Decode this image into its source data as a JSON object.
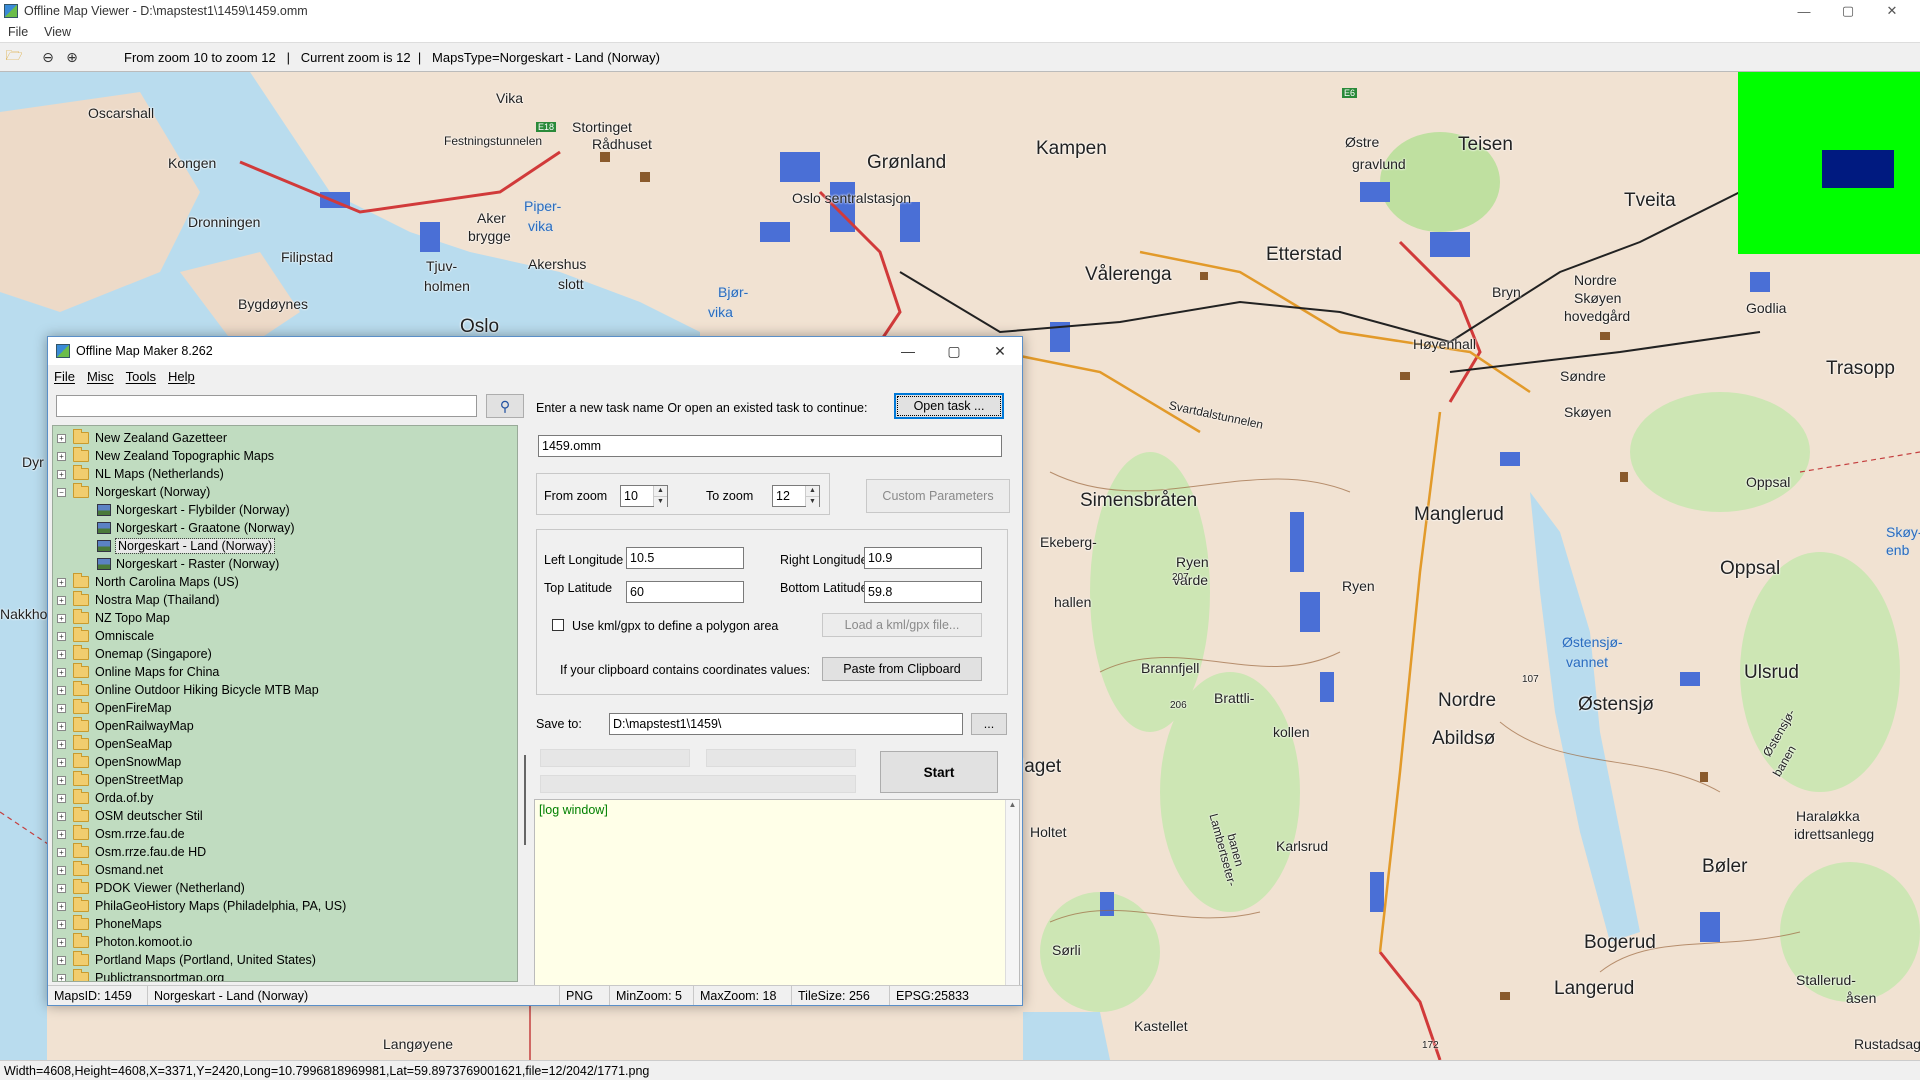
{
  "window": {
    "title": "Offline Map Viewer - D:\\mapstest1\\1459\\1459.omm",
    "controls": {
      "minimize": "—",
      "maximize": "▢",
      "close": "✕"
    }
  },
  "menubar": {
    "file": "File",
    "view": "View"
  },
  "toolbar": {
    "icons": [
      "folder-open-icon",
      "zoom-out-icon",
      "zoom-in-icon"
    ],
    "info": "From zoom 10 to zoom 12   |   Current zoom is 12  |   MapsType=Norgeskart - Land (Norway)"
  },
  "map": {
    "labels": [
      {
        "text": "Vika",
        "cls": ""
      },
      {
        "text": "Oscarshall",
        "cls": ""
      },
      {
        "text": "Kongen",
        "cls": ""
      },
      {
        "text": "Stortinget",
        "cls": ""
      },
      {
        "text": "Rådhuset",
        "cls": ""
      },
      {
        "text": "Festningstunnelen",
        "cls": ""
      },
      {
        "text": "Grønland",
        "cls": "big"
      },
      {
        "text": "Kampen",
        "cls": "big"
      },
      {
        "text": "Østre",
        "cls": ""
      },
      {
        "text": "gravlund",
        "cls": ""
      },
      {
        "text": "Teisen",
        "cls": "big"
      },
      {
        "text": "Oslo sentralstasjon",
        "cls": ""
      },
      {
        "text": "Tveita",
        "cls": "big"
      },
      {
        "text": "Dronningen",
        "cls": ""
      },
      {
        "text": "Aker",
        "cls": ""
      },
      {
        "text": "brygge",
        "cls": ""
      },
      {
        "text": "Piper-",
        "cls": "water"
      },
      {
        "text": "vika",
        "cls": "water"
      },
      {
        "text": "Filipstad",
        "cls": ""
      },
      {
        "text": "Tjuv-",
        "cls": ""
      },
      {
        "text": "holmen",
        "cls": ""
      },
      {
        "text": "Akershus",
        "cls": ""
      },
      {
        "text": "slott",
        "cls": ""
      },
      {
        "text": "Vålerenga",
        "cls": "big"
      },
      {
        "text": "Etterstad",
        "cls": "big"
      },
      {
        "text": "Bygdøynes",
        "cls": ""
      },
      {
        "text": "Bjør-",
        "cls": "water"
      },
      {
        "text": "vika",
        "cls": "water"
      },
      {
        "text": "Oslo",
        "cls": "big"
      },
      {
        "text": "Bryn",
        "cls": ""
      },
      {
        "text": "Nordre",
        "cls": ""
      },
      {
        "text": "Skøyen",
        "cls": ""
      },
      {
        "text": "hovedgård",
        "cls": ""
      },
      {
        "text": "Godlia",
        "cls": ""
      },
      {
        "text": "Høyenhall",
        "cls": ""
      },
      {
        "text": "Trasopp",
        "cls": "big"
      },
      {
        "text": "Søndre",
        "cls": ""
      },
      {
        "text": "Skøyen",
        "cls": ""
      },
      {
        "text": "Svartdalstunnelen",
        "cls": ""
      },
      {
        "text": "Simensbråten",
        "cls": "big"
      },
      {
        "text": "Manglerud",
        "cls": "big"
      },
      {
        "text": "Oppsal",
        "cls": ""
      },
      {
        "text": "Oppsal",
        "cls": "big"
      },
      {
        "text": "Ekeberg-",
        "cls": ""
      },
      {
        "text": "hallen",
        "cls": ""
      },
      {
        "text": "Ryen",
        "cls": ""
      },
      {
        "text": "varde",
        "cls": ""
      },
      {
        "text": "Ryen",
        "cls": ""
      },
      {
        "text": "Østensjø-",
        "cls": "water"
      },
      {
        "text": "vannet",
        "cls": "water"
      },
      {
        "text": "Brannfjell",
        "cls": ""
      },
      {
        "text": "Brattli-",
        "cls": ""
      },
      {
        "text": "kollen",
        "cls": ""
      },
      {
        "text": "Nordre",
        "cls": "big"
      },
      {
        "text": "Abildsø",
        "cls": "big"
      },
      {
        "text": "Ulsrud",
        "cls": "big"
      },
      {
        "text": "Østensjø",
        "cls": "big"
      },
      {
        "text": "Skøy-",
        "cls": "water"
      },
      {
        "text": "enb",
        "cls": "water"
      },
      {
        "text": "Haraløkka",
        "cls": ""
      },
      {
        "text": "idrettsanlegg",
        "cls": ""
      },
      {
        "text": "Bøler",
        "cls": "big"
      },
      {
        "text": "Holtet",
        "cls": ""
      },
      {
        "text": "Karlsrud",
        "cls": ""
      },
      {
        "text": "Sørli",
        "cls": ""
      },
      {
        "text": "Bogerud",
        "cls": "big"
      },
      {
        "text": "Langerud",
        "cls": "big"
      },
      {
        "text": "Stallerud-",
        "cls": ""
      },
      {
        "text": "åsen",
        "cls": ""
      },
      {
        "text": "Rustadsag",
        "cls": ""
      },
      {
        "text": "Kastellet",
        "cls": ""
      },
      {
        "text": "Langøyene",
        "cls": ""
      },
      {
        "text": "laget",
        "cls": "big"
      },
      {
        "text": "Dyr",
        "cls": ""
      },
      {
        "text": "Nakkhol",
        "cls": ""
      },
      {
        "text": "Lambertseter-",
        "cls": ""
      },
      {
        "text": "banen",
        "cls": ""
      },
      {
        "text": "Østensjø-",
        "cls": ""
      },
      {
        "text": "banen",
        "cls": ""
      },
      {
        "text": "207",
        "cls": ""
      },
      {
        "text": "206",
        "cls": ""
      },
      {
        "text": "107",
        "cls": ""
      },
      {
        "text": "172",
        "cls": ""
      },
      {
        "text": "E18",
        "cls": ""
      },
      {
        "text": "E6",
        "cls": ""
      }
    ]
  },
  "statusbar": {
    "text": "Width=4608,Height=4608,X=3371,Y=2420,Long=10.7996818969981,Lat=59.8973769001621,file=12/2042/1771.png"
  },
  "dialog": {
    "title": "Offline Map Maker 8.262",
    "menu": [
      "File",
      "Misc",
      "Tools",
      "Help"
    ],
    "search": {
      "value": ""
    },
    "tree": [
      {
        "label": "New Zealand Gazetteer",
        "type": "folder",
        "exp": "+"
      },
      {
        "label": "New Zealand Topographic Maps",
        "type": "folder",
        "exp": "+"
      },
      {
        "label": "NL Maps (Netherlands)",
        "type": "folder",
        "exp": "+"
      },
      {
        "label": "Norgeskart (Norway)",
        "type": "folder",
        "exp": "−"
      },
      {
        "label": "Norgeskart - Flybilder (Norway)",
        "type": "map",
        "exp": ""
      },
      {
        "label": "Norgeskart - Graatone (Norway)",
        "type": "map",
        "exp": ""
      },
      {
        "label": "Norgeskart - Land (Norway)",
        "type": "map",
        "exp": "",
        "selected": true
      },
      {
        "label": "Norgeskart - Raster (Norway)",
        "type": "map",
        "exp": ""
      },
      {
        "label": "North Carolina Maps (US)",
        "type": "folder",
        "exp": "+"
      },
      {
        "label": "Nostra Map (Thailand)",
        "type": "folder",
        "exp": "+"
      },
      {
        "label": "NZ Topo Map",
        "type": "folder",
        "exp": "+"
      },
      {
        "label": "Omniscale",
        "type": "folder",
        "exp": "+"
      },
      {
        "label": "Onemap (Singapore)",
        "type": "folder",
        "exp": "+"
      },
      {
        "label": "Online Maps for China",
        "type": "folder",
        "exp": "+"
      },
      {
        "label": "Online Outdoor Hiking Bicycle MTB Map",
        "type": "folder",
        "exp": "+"
      },
      {
        "label": "OpenFireMap",
        "type": "folder",
        "exp": "+"
      },
      {
        "label": "OpenRailwayMap",
        "type": "folder",
        "exp": "+"
      },
      {
        "label": "OpenSeaMap",
        "type": "folder",
        "exp": "+"
      },
      {
        "label": "OpenSnowMap",
        "type": "folder",
        "exp": "+"
      },
      {
        "label": "OpenStreetMap",
        "type": "folder",
        "exp": "+"
      },
      {
        "label": "Orda.of.by",
        "type": "folder",
        "exp": "+"
      },
      {
        "label": "OSM deutscher Stil",
        "type": "folder",
        "exp": "+"
      },
      {
        "label": "Osm.rrze.fau.de",
        "type": "folder",
        "exp": "+"
      },
      {
        "label": "Osm.rrze.fau.de HD",
        "type": "folder",
        "exp": "+"
      },
      {
        "label": "Osmand.net",
        "type": "folder",
        "exp": "+"
      },
      {
        "label": "PDOK Viewer (Netherland)",
        "type": "folder",
        "exp": "+"
      },
      {
        "label": "PhilaGeoHistory Maps (Philadelphia, PA, US)",
        "type": "folder",
        "exp": "+"
      },
      {
        "label": "PhoneMaps",
        "type": "folder",
        "exp": "+"
      },
      {
        "label": "Photon.komoot.io",
        "type": "folder",
        "exp": "+"
      },
      {
        "label": "Portland Maps (Portland, United States)",
        "type": "folder",
        "exp": "+"
      },
      {
        "label": "Publictransportmap.org",
        "type": "folder",
        "exp": "+"
      }
    ],
    "task": {
      "prompt": "Enter a new task name Or open an existed task to continue:",
      "open_button": "Open task ...",
      "name_value": "1459.omm"
    },
    "zoom": {
      "from_label": "From zoom",
      "from_value": "10",
      "to_label": "To zoom",
      "to_value": "12",
      "custom_button": "Custom Parameters"
    },
    "coords": {
      "left_lon_label": "Left Longitude",
      "left_lon": "10.5",
      "right_lon_label": "Right Longitude",
      "right_lon": "10.9",
      "top_lat_label": "Top Latitude",
      "top_lat": "60",
      "bottom_lat_label": "Bottom Latitude",
      "bottom_lat": "59.8",
      "kml_label": "Use kml/gpx to define a polygon area",
      "kml_button": "Load a kml/gpx file...",
      "clipboard_label": "If your clipboard contains coordinates values:",
      "clipboard_button": "Paste from Clipboard"
    },
    "save": {
      "label": "Save to:",
      "value": "D:\\mapstest1\\1459\\",
      "browse": "..."
    },
    "start_button": "Start",
    "log_text": "[log window]",
    "status": {
      "maps_id": "MapsID: 1459",
      "maps_name": "Norgeskart - Land (Norway)",
      "format": "PNG",
      "min_zoom": "MinZoom: 5",
      "max_zoom": "MaxZoom: 18",
      "tile_size": "TileSize: 256",
      "epsg": "EPSG:25833"
    }
  }
}
